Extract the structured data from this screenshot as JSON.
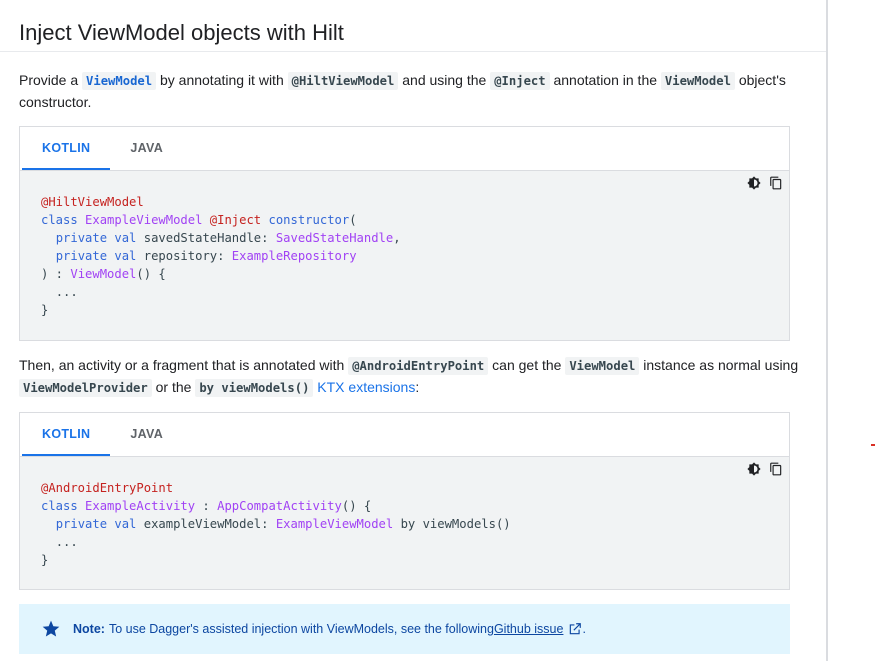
{
  "heading": "Inject ViewModel objects with Hilt",
  "para1": {
    "t1": "Provide a ",
    "c1": "ViewModel",
    "t2": " by annotating it with ",
    "c2": "@HiltViewModel",
    "t3": " and using the ",
    "c3": "@Inject",
    "t4": " annotation in the ",
    "c4": "ViewModel",
    "t5": " object's constructor."
  },
  "tabs": {
    "kotlin": "KOTLIN",
    "java": "JAVA"
  },
  "code1": {
    "l1_ann": "@HiltViewModel",
    "l2_kw": "class",
    "l2_type": "ExampleViewModel",
    "l2_ann": "@Inject",
    "l2_kw2": "constructor",
    "l2_end": "(",
    "l3_kw": "private val",
    "l3_name": " savedStateHandle: ",
    "l3_type": "SavedStateHandle",
    "l3_end": ",",
    "l4_kw": "private val",
    "l4_name": " repository: ",
    "l4_type": "ExampleRepository",
    "l5_start": ") : ",
    "l5_type": "ViewModel",
    "l5_end": "() {",
    "l6": "...",
    "l7": "}"
  },
  "para2": {
    "t1": "Then, an activity or a fragment that is annotated with ",
    "c1": "@AndroidEntryPoint",
    "t2": " can get the ",
    "c2": "ViewModel",
    "t3": " instance as normal using ",
    "c3": "ViewModelProvider",
    "t4": " or the ",
    "c4": "by viewModels()",
    "t5": " ",
    "link": "KTX extensions",
    "t6": ":"
  },
  "code2": {
    "l1_ann": "@AndroidEntryPoint",
    "l2_kw": "class",
    "l2_type": "ExampleActivity",
    "l2_mid": " : ",
    "l2_type2": "AppCompatActivity",
    "l2_end": "() {",
    "l3_kw": "private val",
    "l3_name": " exampleViewModel: ",
    "l3_type": "ExampleViewModel",
    "l3_end": " by viewModels()",
    "l4": "...",
    "l5": "}"
  },
  "note": {
    "label": "Note:",
    "text": "To use Dagger's assisted injection with ViewModels, see the following ",
    "link": "Github issue",
    "end": "."
  },
  "icons": {
    "theme": "theme-toggle-icon",
    "copy": "copy-icon",
    "star": "star-icon",
    "external": "external-link-icon"
  },
  "colors": {
    "accent": "#1a73e8",
    "annotation": "#c5221f",
    "keyword": "#3367d6",
    "type": "#a142f4",
    "note_bg": "#e1f5fe"
  }
}
